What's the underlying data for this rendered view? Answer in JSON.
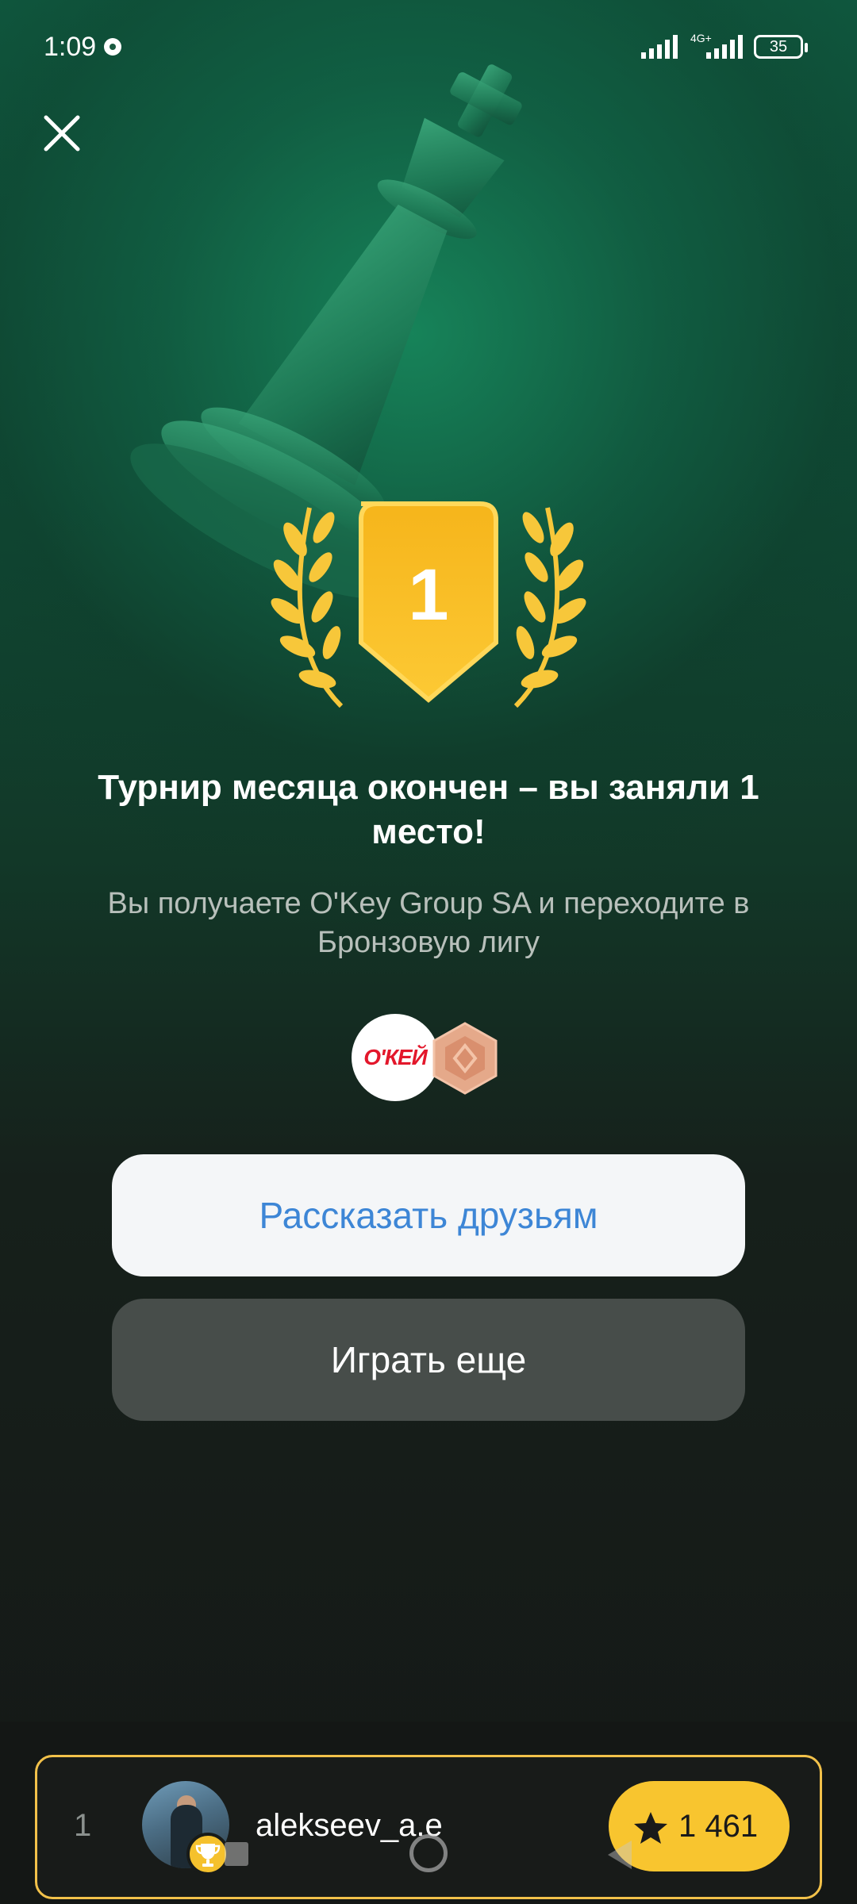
{
  "status_bar": {
    "time": "1:09",
    "network": "4G+",
    "battery": "35"
  },
  "award": {
    "place": "1"
  },
  "message": {
    "headline": "Турнир месяца окончен – вы заняли 1 место!",
    "subline": "Вы получаете O'Key Group SA и переходите в Бронзовую лигу"
  },
  "badges": {
    "sponsor_logo": "О'КЕЙ"
  },
  "buttons": {
    "share": "Рассказать друзьям",
    "play_again": "Играть еще"
  },
  "player": {
    "rank": "1",
    "username": "alekseev_a.e",
    "score": "1 461"
  },
  "colors": {
    "accent_gold": "#f8c52f",
    "share_text": "#3d86d6",
    "background_green": "#0f5a40"
  },
  "icons": [
    "close-icon",
    "trophy-icon",
    "star-icon",
    "chess-king-illustration",
    "laurel-wreath",
    "bronze-league-icon"
  ]
}
